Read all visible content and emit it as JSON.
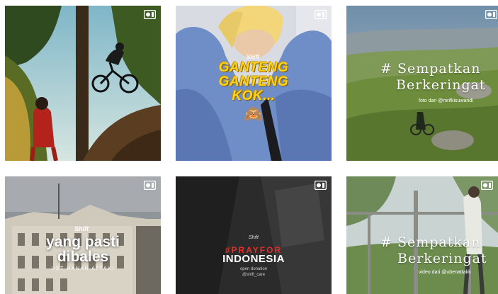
{
  "grid": {
    "posts": [
      {
        "id": "mountain-bike",
        "type": "video",
        "icon": "video-icon"
      },
      {
        "id": "ganteng",
        "type": "video",
        "icon": "video-icon",
        "brand": "Shift",
        "lines": [
          "GANTENG",
          "GANTENG",
          "KOK..."
        ],
        "emoji": "🙈"
      },
      {
        "id": "sempatkan-1",
        "type": "video",
        "icon": "video-icon",
        "lines": [
          "# Sempatkan",
          "Berkeringat"
        ],
        "credit": "foto dari @mrifkisuwandi"
      },
      {
        "id": "yang-pasti",
        "type": "video",
        "icon": "video-icon",
        "brand": "Shift",
        "lines": [
          "yang pasti",
          "dibales"
        ],
        "credit": "UST HANAN ATTAKI"
      },
      {
        "id": "pray-for-indonesia",
        "type": "video",
        "icon": "video-icon",
        "brand": "Shift",
        "hashtag": "#PRAYFOR",
        "title": "INDONESIA",
        "donation_line1": "open donation",
        "donation_line2": "@shift_care"
      },
      {
        "id": "sempatkan-2",
        "type": "video",
        "icon": "video-icon",
        "lines": [
          "# Sempatkan",
          "Berkeringat"
        ],
        "credit": "video dari @ubenattakk"
      }
    ]
  },
  "colors": {
    "accent_yellow": "#ffd21f",
    "accent_red": "#e0302b"
  }
}
